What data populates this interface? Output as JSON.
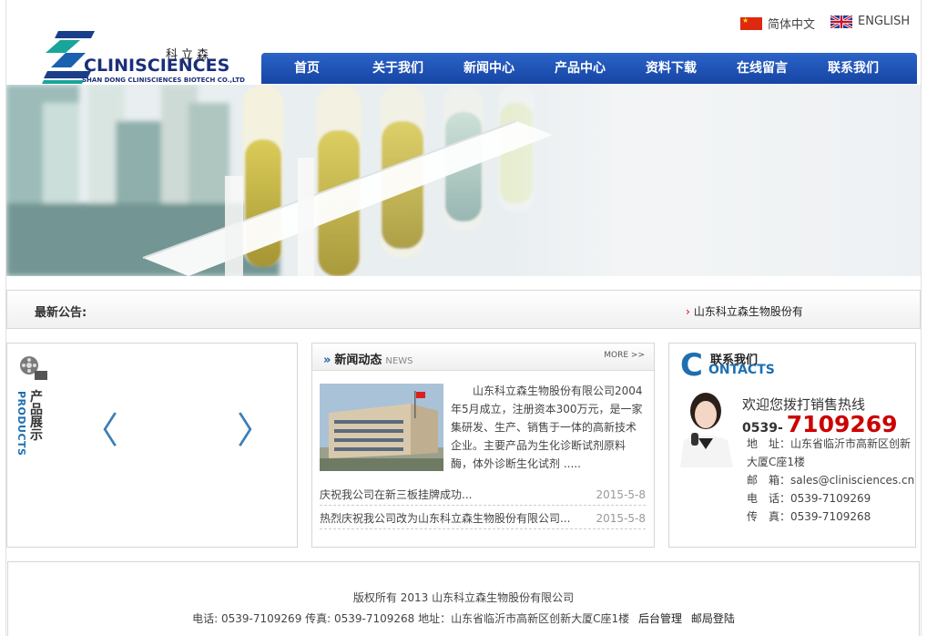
{
  "header": {
    "lang_cn": "简体中文",
    "lang_en": "ENGLISH",
    "logo": {
      "cn": "科立森",
      "main": "CLINISCIENCES",
      "sub": "SHAN DONG CLINISCIENCES BIOTECH CO.,LTD"
    },
    "nav": [
      "首页",
      "关于我们",
      "新闻中心",
      "产品中心",
      "资料下载",
      "在线留言",
      "联系我们"
    ]
  },
  "notice": {
    "label": "最新公告:",
    "item": "山东科立森生物股份有限公司"
  },
  "products": {
    "title": "产品展示",
    "title_en": "PRODUCTS",
    "prev": "〈",
    "next": "〉"
  },
  "news": {
    "title": "新闻动态",
    "title_en": "NEWS",
    "more": "MORE >>",
    "summary": "山东科立森生物股份有限公司2004年5月成立，注册资本300万元，是一家集研发、生产、销售于一体的高新技术企业。主要产品为生化诊断试剂原料酶，体外诊断生化试剂 .....",
    "items": [
      {
        "title": "庆祝我公司在新三板挂牌成功...",
        "date": "2015-5-8"
      },
      {
        "title": "热烈庆祝我公司改为山东科立森生物股份有限公司...",
        "date": "2015-5-8"
      }
    ]
  },
  "contact": {
    "big": "C",
    "title_cn": "联系我们",
    "title_en": "ONTACTS",
    "hotline": "欢迎您拨打销售热线",
    "phone_prefix": "0539-",
    "phone_number": "7109269",
    "address": "地　址：山东省临沂市高新区创新大厦C座1楼",
    "email": "邮　箱：sales@clinisciences.cn",
    "tel": "电　话：0539-7109269",
    "fax": "传　真：0539-7109268"
  },
  "footer": {
    "copyright": "版权所有 2013 山东科立森生物股份有限公司",
    "info": "电话: 0539-7109269   传真: 0539-7109268  地址：山东省临沂市高新区创新大厦C座1楼",
    "admin": "后台管理",
    "mail_login": "邮局登陆"
  },
  "colors": {
    "nav": "#1e52b4",
    "accent": "#1e6fb0",
    "phone": "#cc0000"
  }
}
